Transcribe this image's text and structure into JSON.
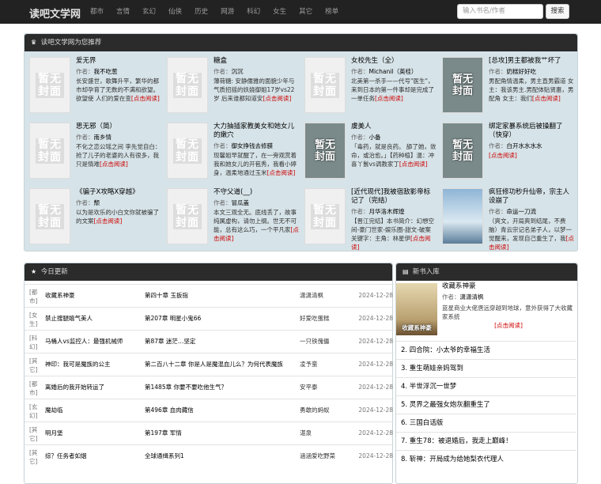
{
  "site": {
    "name": "读吧文学网",
    "nav": [
      "都市",
      "言情",
      "玄幻",
      "仙侠",
      "历史",
      "网游",
      "科幻",
      "女生",
      "其它",
      "榜单"
    ],
    "search_placeholder": "输入书名/作者",
    "search_btn": "搜索"
  },
  "recommend": {
    "title": "读吧文学网为您推荐",
    "author_prefix": "作者：",
    "read_label": "[点击阅读]",
    "books": [
      {
        "title": "爱无界",
        "author": "我不吃葱",
        "desc": "长安盛世，歌舞升平，繁华的都市却孕育了无数的不满和欲望。欲望使 人们的爱在变",
        "cover": "none"
      },
      {
        "title": "糖盒",
        "author": "沉沉",
        "desc": "薄荷糖: 安静儒雅的面貌少年与气质招摇的妖娆御姐17岁vs22岁 后来谁都知道安",
        "cover": "none"
      },
      {
        "title": "女校先生（全）",
        "author": "Michanil（英桂）",
        "desc": "北美第一杀手——代号\"医生\"，来到日本的第一件事却是完成了一单任务",
        "cover": "none"
      },
      {
        "title": "[总攻]男主都被我艹坏了",
        "author": "奶糕好好吃",
        "desc": "男配角情温柔，男主直男霸道 女主：我该男主.男配体贴贤惠，男配角 女主：我们",
        "cover": "img"
      },
      {
        "title": "思无邪（简）",
        "author": "南乡情",
        "desc": "不化之恋公瑶之间 李先觉自白：抢了儿子的老婆的人有很多，我只是情难",
        "cover": "none"
      },
      {
        "title": "大力抽插家教美女和她女儿的嫩穴",
        "author": "御女挣钱去修膜",
        "desc": "现馨姐早就醒了，在一旁观赏着我和她女儿的开苞秀，我看小婷 身，温柔地通过玉米",
        "cover": "none"
      },
      {
        "title": "虞美人",
        "author": "小备",
        "desc": "「毒药，就是良药。 舔了她，敛命，或治愈。」【药种植】温：冲喜丫鬟vs调教家丁",
        "cover": "img"
      },
      {
        "title": "绑定家暴系统后被操翻了（快穿）",
        "author": "白开水水水水",
        "desc": "",
        "cover": "img"
      },
      {
        "title": "《骗子X攻略X穿越》",
        "author": "颓",
        "desc": "以为是欢乐的小白文你就被骗了的文案",
        "cover": "none"
      },
      {
        "title": "不守父道(__)",
        "author": "冒瓜盖",
        "desc": "本文三观全无。底线丢了，故事纯属虚构，请勿上纲。世无不可能，总有这么巧，一个平凡家",
        "cover": "none"
      },
      {
        "title": "[近代现代]我被宿敌影帝标记了（完结）",
        "author": "月华洛木辉煌",
        "desc": "【晋江完结】本书简介：幻想空间-豪门世家-娱乐圈-甜文-破案关键字：主角：林星伊",
        "cover": "none"
      },
      {
        "title": "疯狂修功秒升仙帝，宗主人设崩了",
        "author": "命运一刀流",
        "desc": "（爽文，开局爽到结尾，不费脑）青云宗记名弟子人，以梦一觉醒来，发现自己重生了，我",
        "cover": "img2"
      }
    ]
  },
  "updates": {
    "title": "今日更新",
    "rows": [
      {
        "cat": "[都市]",
        "book": "收藏系神豪",
        "chapter": "第四十章 玉扳指",
        "author": "潇潇清枫",
        "date": "2024-12-28"
      },
      {
        "cat": "[女生]",
        "book": "禁止搜腿嬉气美人",
        "chapter": "第207章 明星小鬼66",
        "author": "好爱吃蛋糕",
        "date": "2024-12-28"
      },
      {
        "cat": "[科幻]",
        "book": "马桶人vs监控人：最强机械师",
        "chapter": "第87章 迷茫…坚定",
        "author": "一只铁傀儡",
        "date": "2024-12-28"
      },
      {
        "cat": "[其它]",
        "book": "神印：我可是魔族的公主",
        "chapter": "第二百八十二章 你是人是魔混血儿么？为何代表魔族立场！",
        "author": "凌予蛮",
        "date": "2024-12-28"
      },
      {
        "cat": "[都市]",
        "book": "离婚后的我开始转运了",
        "chapter": "第1485章 你要不要吃他生气？",
        "author": "安平泰",
        "date": "2024-12-28"
      },
      {
        "cat": "[玄幻]",
        "book": "魔劫临",
        "chapter": "第496章 血肉藏信",
        "author": "勇敢的蚂蚁",
        "date": "2024-12-28"
      },
      {
        "cat": "[其它]",
        "book": "明月堡",
        "chapter": "第197章 军情",
        "author": "湛泉",
        "date": "2024-12-28"
      },
      {
        "cat": "[其它]",
        "book": "综？任务者如烟",
        "chapter": "全球通缉系列1",
        "author": "涵涵爱吃野菜",
        "date": "2024-12-28"
      }
    ]
  },
  "newbooks": {
    "title": "新书入库",
    "top": {
      "title": "收藏系神豪",
      "author_prefix": "作者：",
      "author": "潇潇清枫",
      "desc": "蓝星商业大佬唐远穿越到地球，意外获得了大收藏家系统",
      "read": "[点击阅读]",
      "cover_text": "收藏系神豪"
    },
    "list": [
      "2. 四合院：小太爷的幸福生活",
      "3. 重生萌娃亲妈驾到",
      "4. 半世浮沉一世梦",
      "5. 灵界之最强女炮灰翻重生了",
      "6. 三国白话版",
      "7. 重生78：被退婚后，我走上巅峰！",
      "8. 斩神：开局成为给她梨衣代理人"
    ]
  }
}
